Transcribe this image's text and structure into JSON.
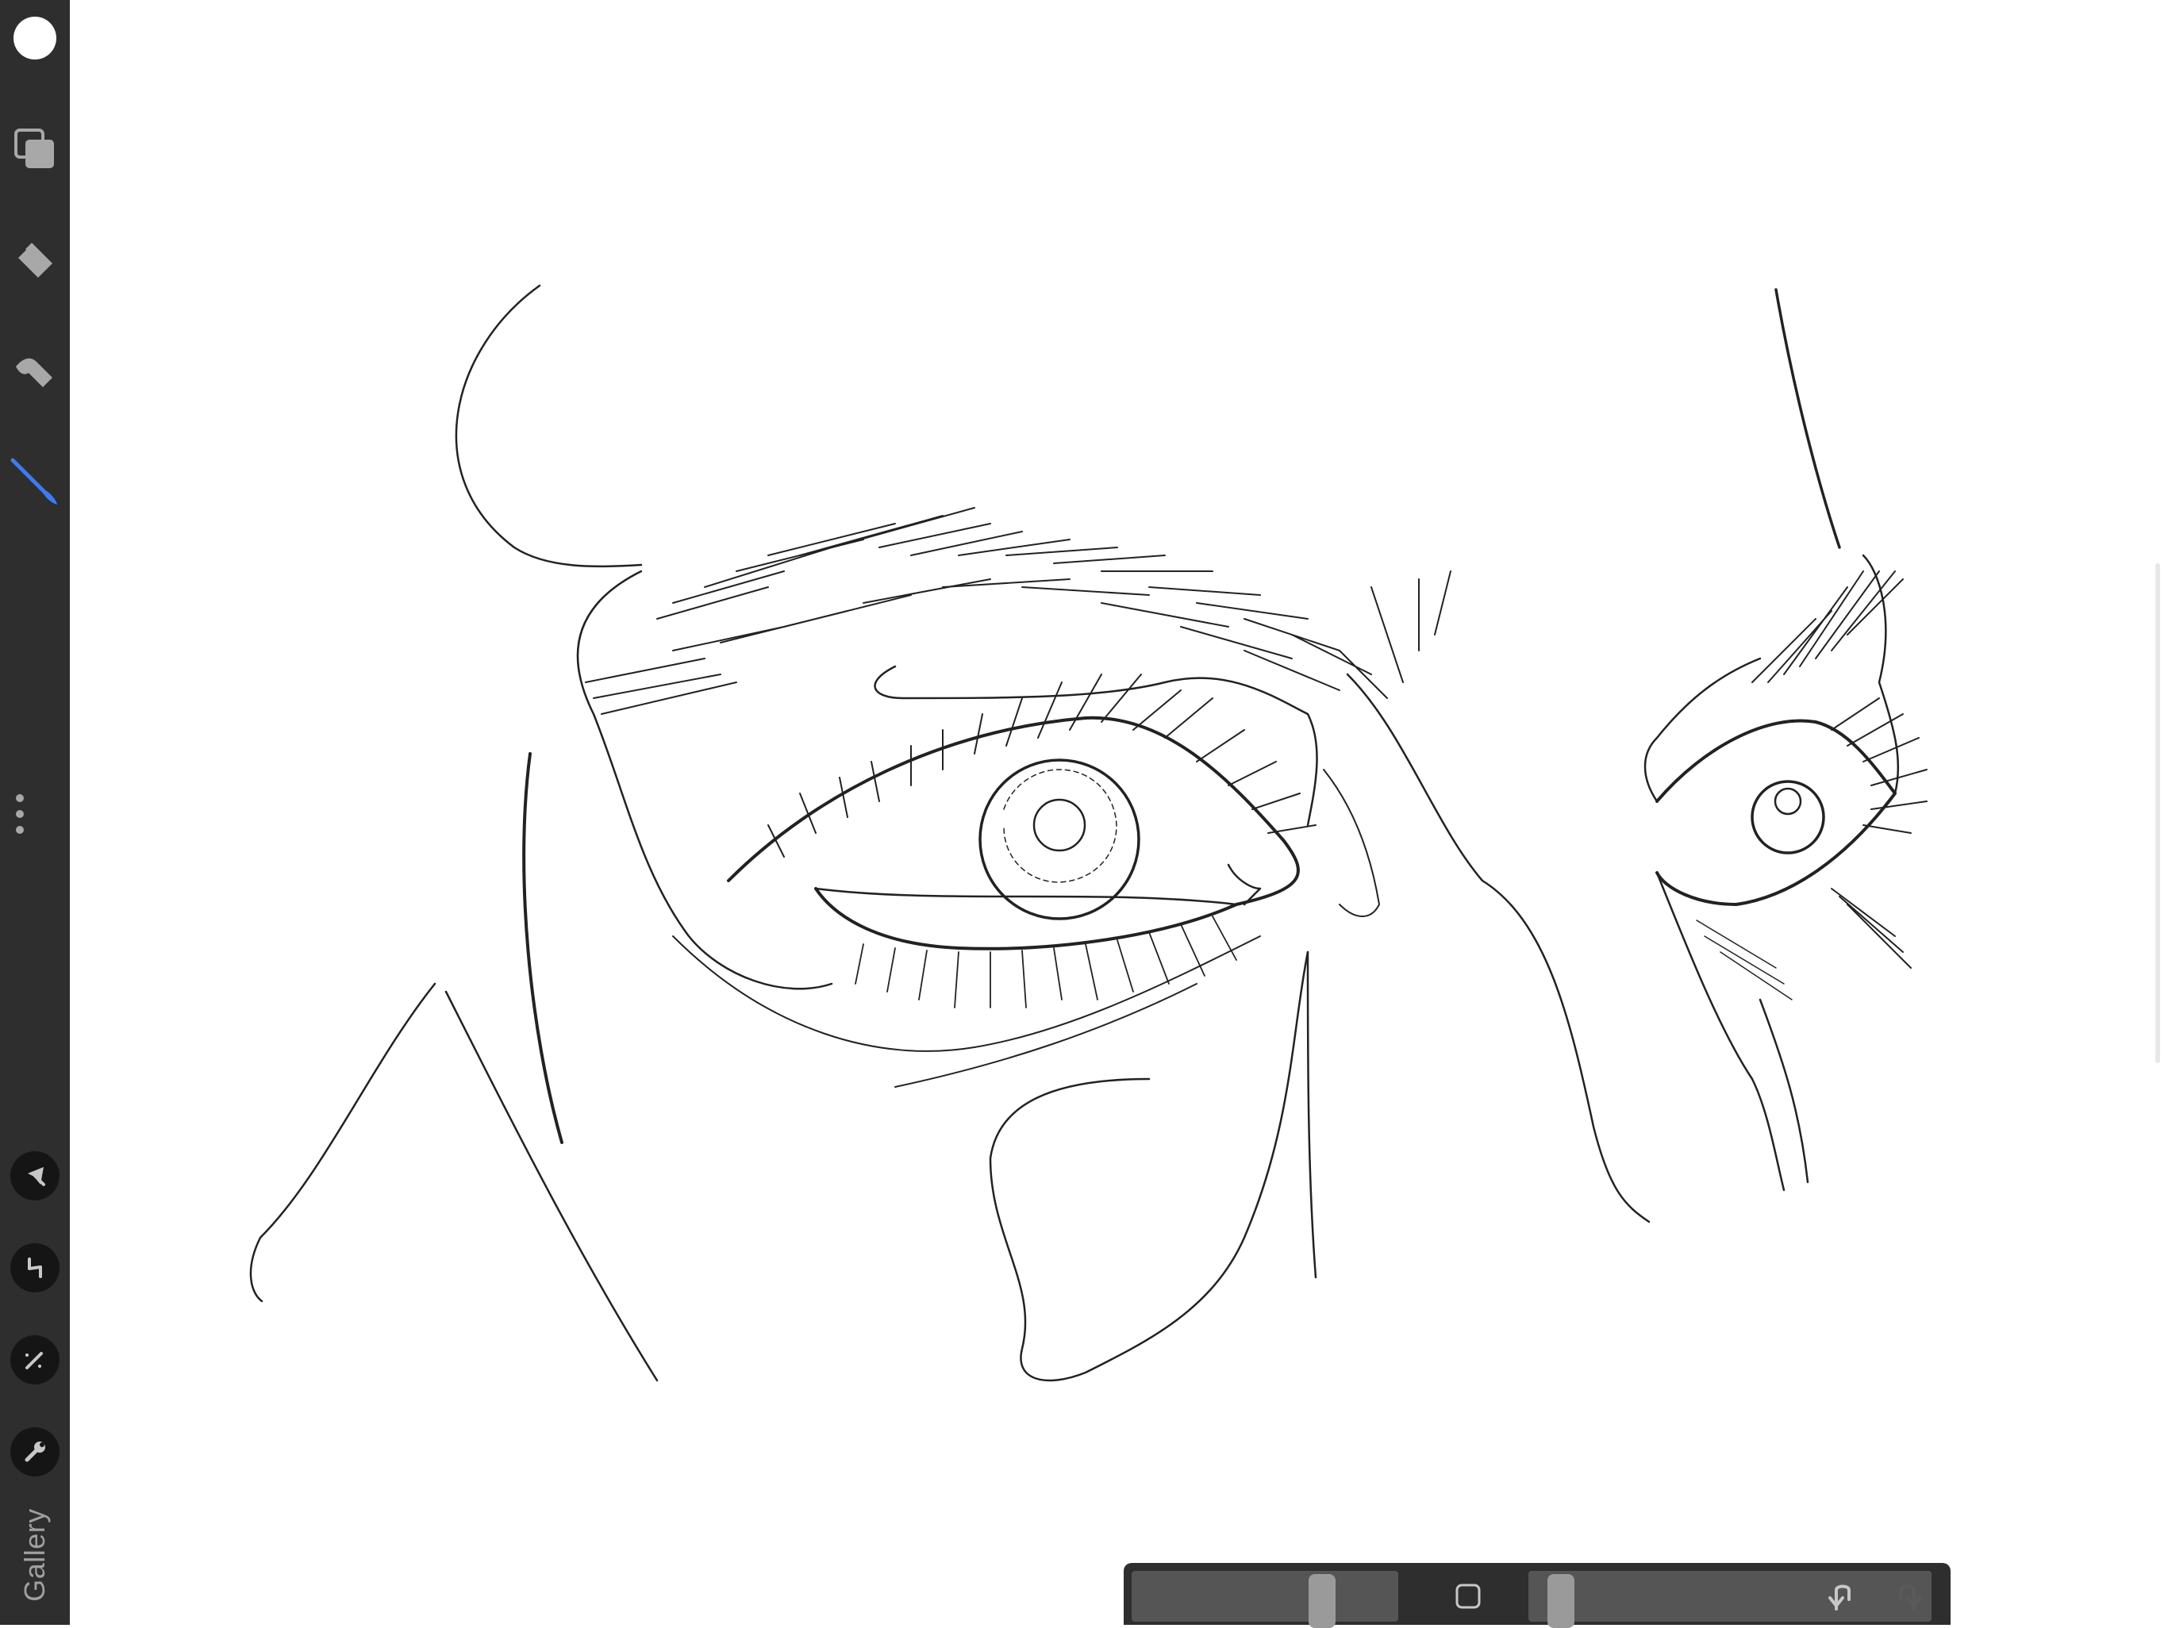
{
  "app": {
    "gallery_label": "Gallery"
  },
  "sidebar": {
    "tools": [
      {
        "name": "color-picker",
        "icon": "white-circle-icon"
      },
      {
        "name": "layers",
        "icon": "layers-icon"
      },
      {
        "name": "eraser",
        "icon": "eraser-icon"
      },
      {
        "name": "smudge",
        "icon": "smudge-icon"
      },
      {
        "name": "brush",
        "icon": "brush-icon",
        "active": true
      }
    ],
    "lower_tools": [
      {
        "name": "selection",
        "icon": "arrow-cursor-icon"
      },
      {
        "name": "transform",
        "icon": "transform-icon"
      },
      {
        "name": "adjustments",
        "icon": "magic-wand-icon"
      },
      {
        "name": "actions",
        "icon": "wrench-icon"
      }
    ]
  },
  "bottom_bar": {
    "brush_size": 0.74,
    "opacity": 0.05
  },
  "colors": {
    "toolbar": "#2e2e2e",
    "accent": "#3d7bf0",
    "canvas": "#ffffff",
    "ink": "#222222"
  }
}
